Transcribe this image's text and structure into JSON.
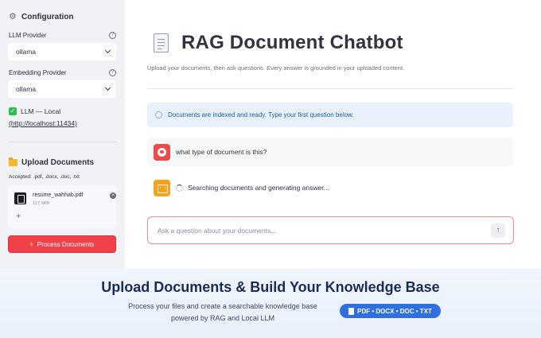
{
  "sidebar": {
    "title": "Configuration",
    "llm_provider_label": "LLM Provider",
    "llm_provider_value": "ollama",
    "embedding_provider_label": "Embedding Provider",
    "embedding_provider_value": "ollama",
    "status_text": "LLM — Local",
    "status_url": "(http://localhost:11434)",
    "upload_title": "Upload Documents",
    "accepted": "Accepted: .pdf, .docx, .doc, .txt",
    "file": {
      "name": "resume_wahhab.pdf",
      "size": "127.9KB"
    },
    "add_label": "+",
    "process_button": "Process Documents"
  },
  "main": {
    "title": "RAG Document Chatbot",
    "subtitle": "Upload your documents, then ask questions. Every answer is grounded in your uploaded content.",
    "info_message": "Documents are indexed and ready. Type your first question below.",
    "user_message": "what type of document is this?",
    "bot_message": "Searching documents and generating answer...",
    "input_placeholder": "Ask a question about your documents...",
    "send_icon": "↑"
  },
  "banner": {
    "title": "Upload Documents & Build Your Knowledge Base",
    "line1": "Process your files and create a searchable knowledge base",
    "line2": "powered by RAG and Local LLM",
    "formats": "PDF • DOCX • DOC • TXT"
  },
  "colors": {
    "primary_button": "#f0414a",
    "info_bg": "#e8f1fc",
    "pill": "#2f6fe0",
    "banner_title": "#1a2a57"
  }
}
